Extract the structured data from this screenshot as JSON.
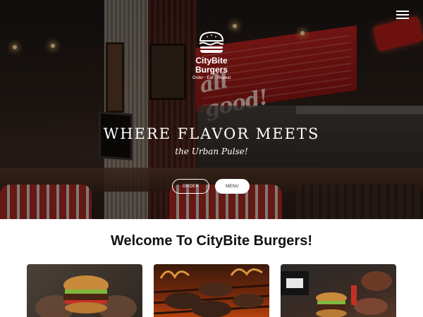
{
  "brand": {
    "name": "CityBite Burgers",
    "tagline": "Order · Eat · Repeat"
  },
  "hero": {
    "headline": "WHERE FLAVOR MEETS",
    "subheadline": "the Urban Pulse!",
    "sign_text": "all good!",
    "buttons": {
      "order": "ORDER",
      "menu": "MENU"
    }
  },
  "nav": {
    "menu_icon": "hamburger-menu-icon"
  },
  "content": {
    "welcome_title": "Welcome To CityBite Burgers!",
    "cards": [
      {
        "image": "burger-in-hands-photo"
      },
      {
        "image": "grilling-patties-photo"
      },
      {
        "image": "diner-table-burger-photo"
      }
    ]
  },
  "colors": {
    "accent_red": "#b4211d",
    "text_dark": "#111111",
    "white": "#ffffff"
  }
}
